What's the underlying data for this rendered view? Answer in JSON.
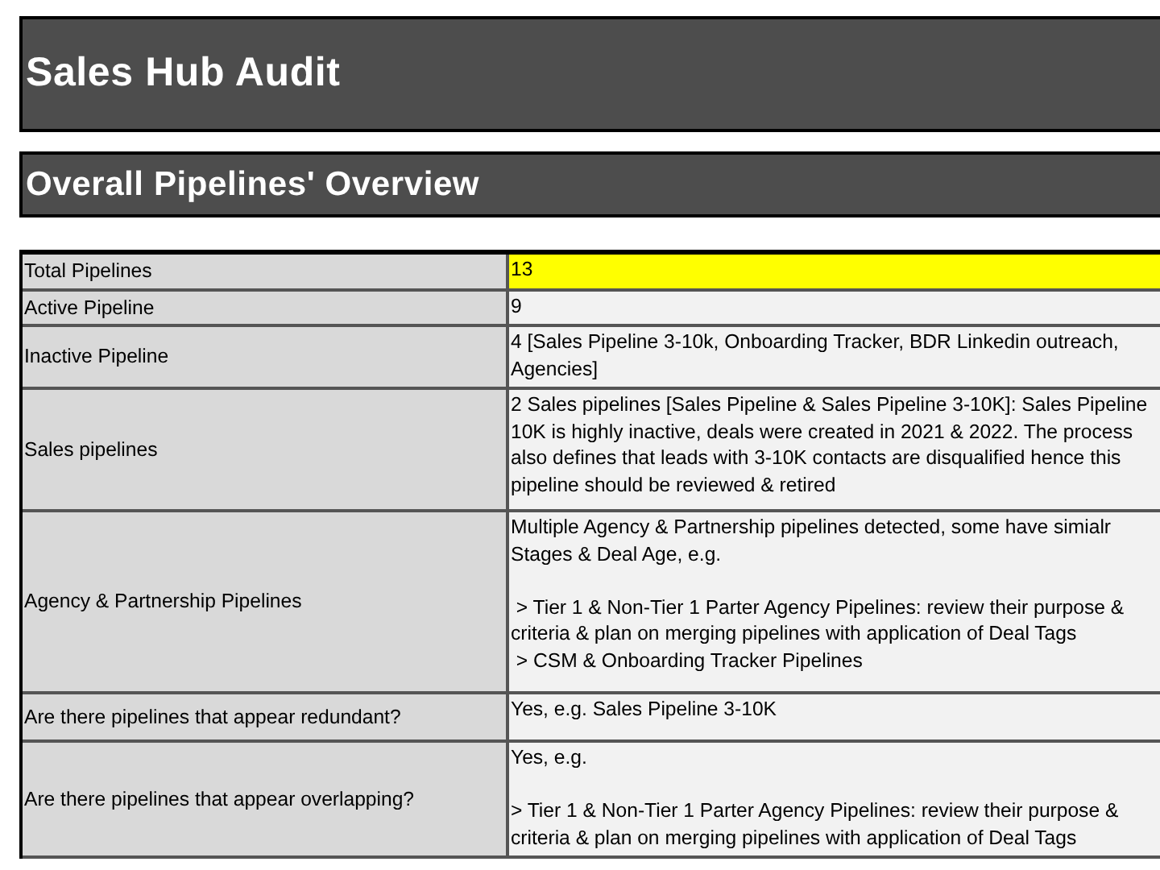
{
  "title": "Sales Hub Audit",
  "section_title": "Overall Pipelines' Overview",
  "rows": [
    {
      "label": "Total Pipelines",
      "value": "13",
      "highlighted": true
    },
    {
      "label": "Active Pipeline",
      "value": "9",
      "highlighted": false
    },
    {
      "label": "Inactive Pipeline",
      "value": "4 [Sales Pipeline 3-10k, Onboarding Tracker, BDR Linkedin outreach,\nAgencies]",
      "highlighted": false
    },
    {
      "label": "Sales pipelines",
      "value": "2 Sales pipelines [Sales Pipeline & Sales Pipeline 3-10K]: Sales Pipeline\n10K is highly inactive, deals were created in 2021 & 2022. The process\nalso defines that leads with 3-10K contacts are disqualified hence this\npipeline should be reviewed & retired",
      "highlighted": false
    },
    {
      "label": "Agency & Partnership Pipelines",
      "value": "Multiple Agency & Partnership pipelines detected, some have simialr\nStages & Deal Age, e.g.\n\n > Tier 1 & Non-Tier 1 Parter Agency Pipelines: review their purpose &\ncriteria & plan on merging pipelines with application of Deal Tags\n > CSM & Onboarding Tracker Pipelines",
      "highlighted": false
    },
    {
      "label": "Are there pipelines that appear redundant?",
      "value": "Yes, e.g. Sales Pipeline 3-10K",
      "highlighted": false
    },
    {
      "label": "Are there pipelines that appear overlapping?",
      "value": "Yes, e.g.\n\n> Tier 1 & Non-Tier 1 Parter Agency Pipelines: review their purpose &\ncriteria & plan on merging pipelines with application of Deal Tags",
      "highlighted": false
    }
  ]
}
